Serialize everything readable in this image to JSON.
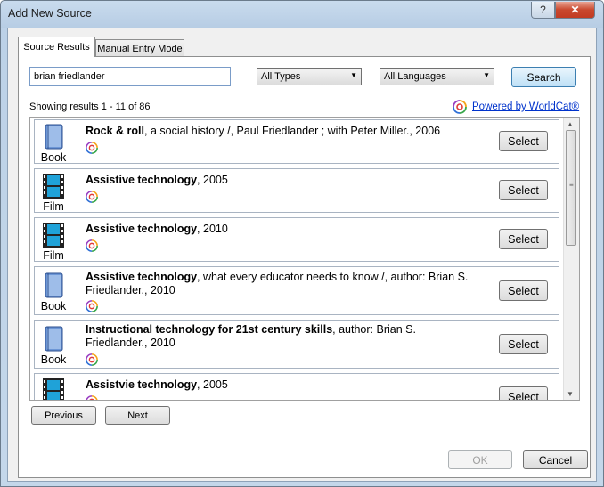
{
  "window": {
    "title": "Add New Source",
    "help_label": "?",
    "close_label": "✕"
  },
  "tabs": [
    {
      "label": "Source Results",
      "active": true
    },
    {
      "label": "Manual Entry Mode",
      "active": false
    }
  ],
  "search": {
    "query": "brian friedlander",
    "type_filter": "All Types",
    "language_filter": "All Languages",
    "button_label": "Search"
  },
  "results_count": "Showing results 1 - 11 of 86",
  "powered_by": "Powered by WorldCat®",
  "results": [
    {
      "type": "Book",
      "title": "Rock & roll",
      "detail": ", a social history /, Paul Friedlander ; with Peter Miller., 2006",
      "select_label": "Select"
    },
    {
      "type": "Film",
      "title": "Assistive technology",
      "detail": ", 2005",
      "select_label": "Select"
    },
    {
      "type": "Film",
      "title": "Assistive technology",
      "detail": ", 2010",
      "select_label": "Select"
    },
    {
      "type": "Book",
      "title": "Assistive technology",
      "detail": ", what every educator needs to know /, author: Brian S. Friedlander., 2010",
      "select_label": "Select"
    },
    {
      "type": "Book",
      "title": "Instructional technology for 21st century skills",
      "detail": ", author: Brian S. Friedlander., 2010",
      "select_label": "Select"
    },
    {
      "type": "Film",
      "title": "Assistvie technology",
      "detail": ", 2005",
      "select_label": "Select"
    }
  ],
  "pager": {
    "previous_label": "Previous",
    "next_label": "Next"
  },
  "footer": {
    "ok_label": "OK",
    "cancel_label": "Cancel"
  },
  "colors": {
    "link": "#0033cc",
    "book_icon": "#6c96d6",
    "film_icon": "#1fa2d8"
  },
  "icons": {
    "book": "book-icon",
    "film": "film-icon",
    "worldcat": "worldcat-logo-icon"
  }
}
